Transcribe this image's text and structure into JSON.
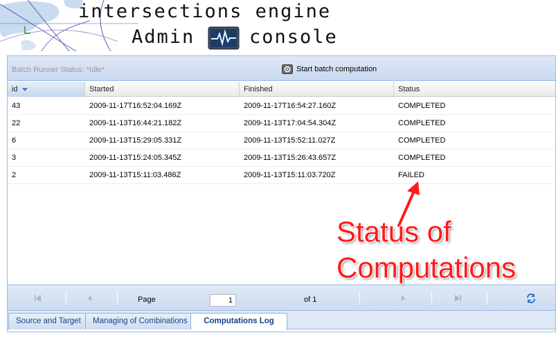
{
  "header": {
    "title_line1": "intersections engine",
    "title_line2_left": "Admin",
    "title_line2_right": "console",
    "icon": "heartbeat-monitor-icon"
  },
  "toolbar": {
    "runner_status": "Batch Runner Status: *Idle*",
    "start_label": "Start batch computation",
    "start_icon": "gear-icon"
  },
  "grid": {
    "columns": [
      "id",
      "Started",
      "Finished",
      "Status"
    ],
    "rows": [
      {
        "id": "43",
        "started": "2009-11-17T16:52:04.169Z",
        "finished": "2009-11-17T16:54:27.160Z",
        "status": "COMPLETED"
      },
      {
        "id": "22",
        "started": "2009-11-13T16:44:21.182Z",
        "finished": "2009-11-13T17:04:54.304Z",
        "status": "COMPLETED"
      },
      {
        "id": "6",
        "started": "2009-11-13T15:29:05.331Z",
        "finished": "2009-11-13T15:52:11.027Z",
        "status": "COMPLETED"
      },
      {
        "id": "3",
        "started": "2009-11-13T15:24:05.345Z",
        "finished": "2009-11-13T15:26:43.657Z",
        "status": "COMPLETED"
      },
      {
        "id": "2",
        "started": "2009-11-13T15:11:03.486Z",
        "finished": "2009-11-13T15:11:03.720Z",
        "status": "FAILED"
      }
    ]
  },
  "pager": {
    "page_label": "Page",
    "page_value": "1",
    "of_label": "of 1"
  },
  "tabs": [
    {
      "label": "Source and Target"
    },
    {
      "label": "Managing of Combinations"
    },
    {
      "label": "Computations Log"
    }
  ],
  "annotation": {
    "text": "Status of\nComputations",
    "color": "#ff1a1a"
  }
}
